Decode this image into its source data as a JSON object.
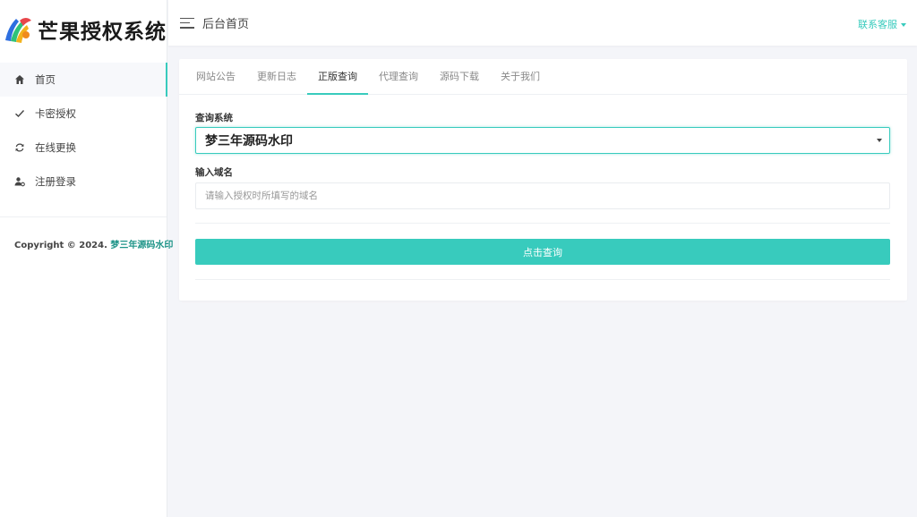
{
  "app": {
    "logo_text": "芒果授权系统",
    "accent_color": "#38cbbd"
  },
  "sidebar": {
    "items": [
      {
        "label": "首页",
        "icon": "home-icon",
        "active": true
      },
      {
        "label": "卡密授权",
        "icon": "check-icon",
        "active": false
      },
      {
        "label": "在线更换",
        "icon": "refresh-icon",
        "active": false
      },
      {
        "label": "注册登录",
        "icon": "user-settings-icon",
        "active": false
      }
    ],
    "copyright_prefix": "Copyright © 2024. ",
    "copyright_brand": "梦三年源码水印"
  },
  "header": {
    "menu_icon": "hamburger-icon",
    "title": "后台首页",
    "support_label": "联系客服"
  },
  "tabs": [
    {
      "label": "网站公告",
      "active": false
    },
    {
      "label": "更新日志",
      "active": false
    },
    {
      "label": "正版查询",
      "active": true
    },
    {
      "label": "代理查询",
      "active": false
    },
    {
      "label": "源码下载",
      "active": false
    },
    {
      "label": "关于我们",
      "active": false
    }
  ],
  "form": {
    "system_label": "查询系统",
    "system_value": "梦三年源码水印",
    "domain_label": "输入域名",
    "domain_value": "",
    "domain_placeholder": "请输入授权时所填写的域名",
    "submit_label": "点击查询"
  }
}
